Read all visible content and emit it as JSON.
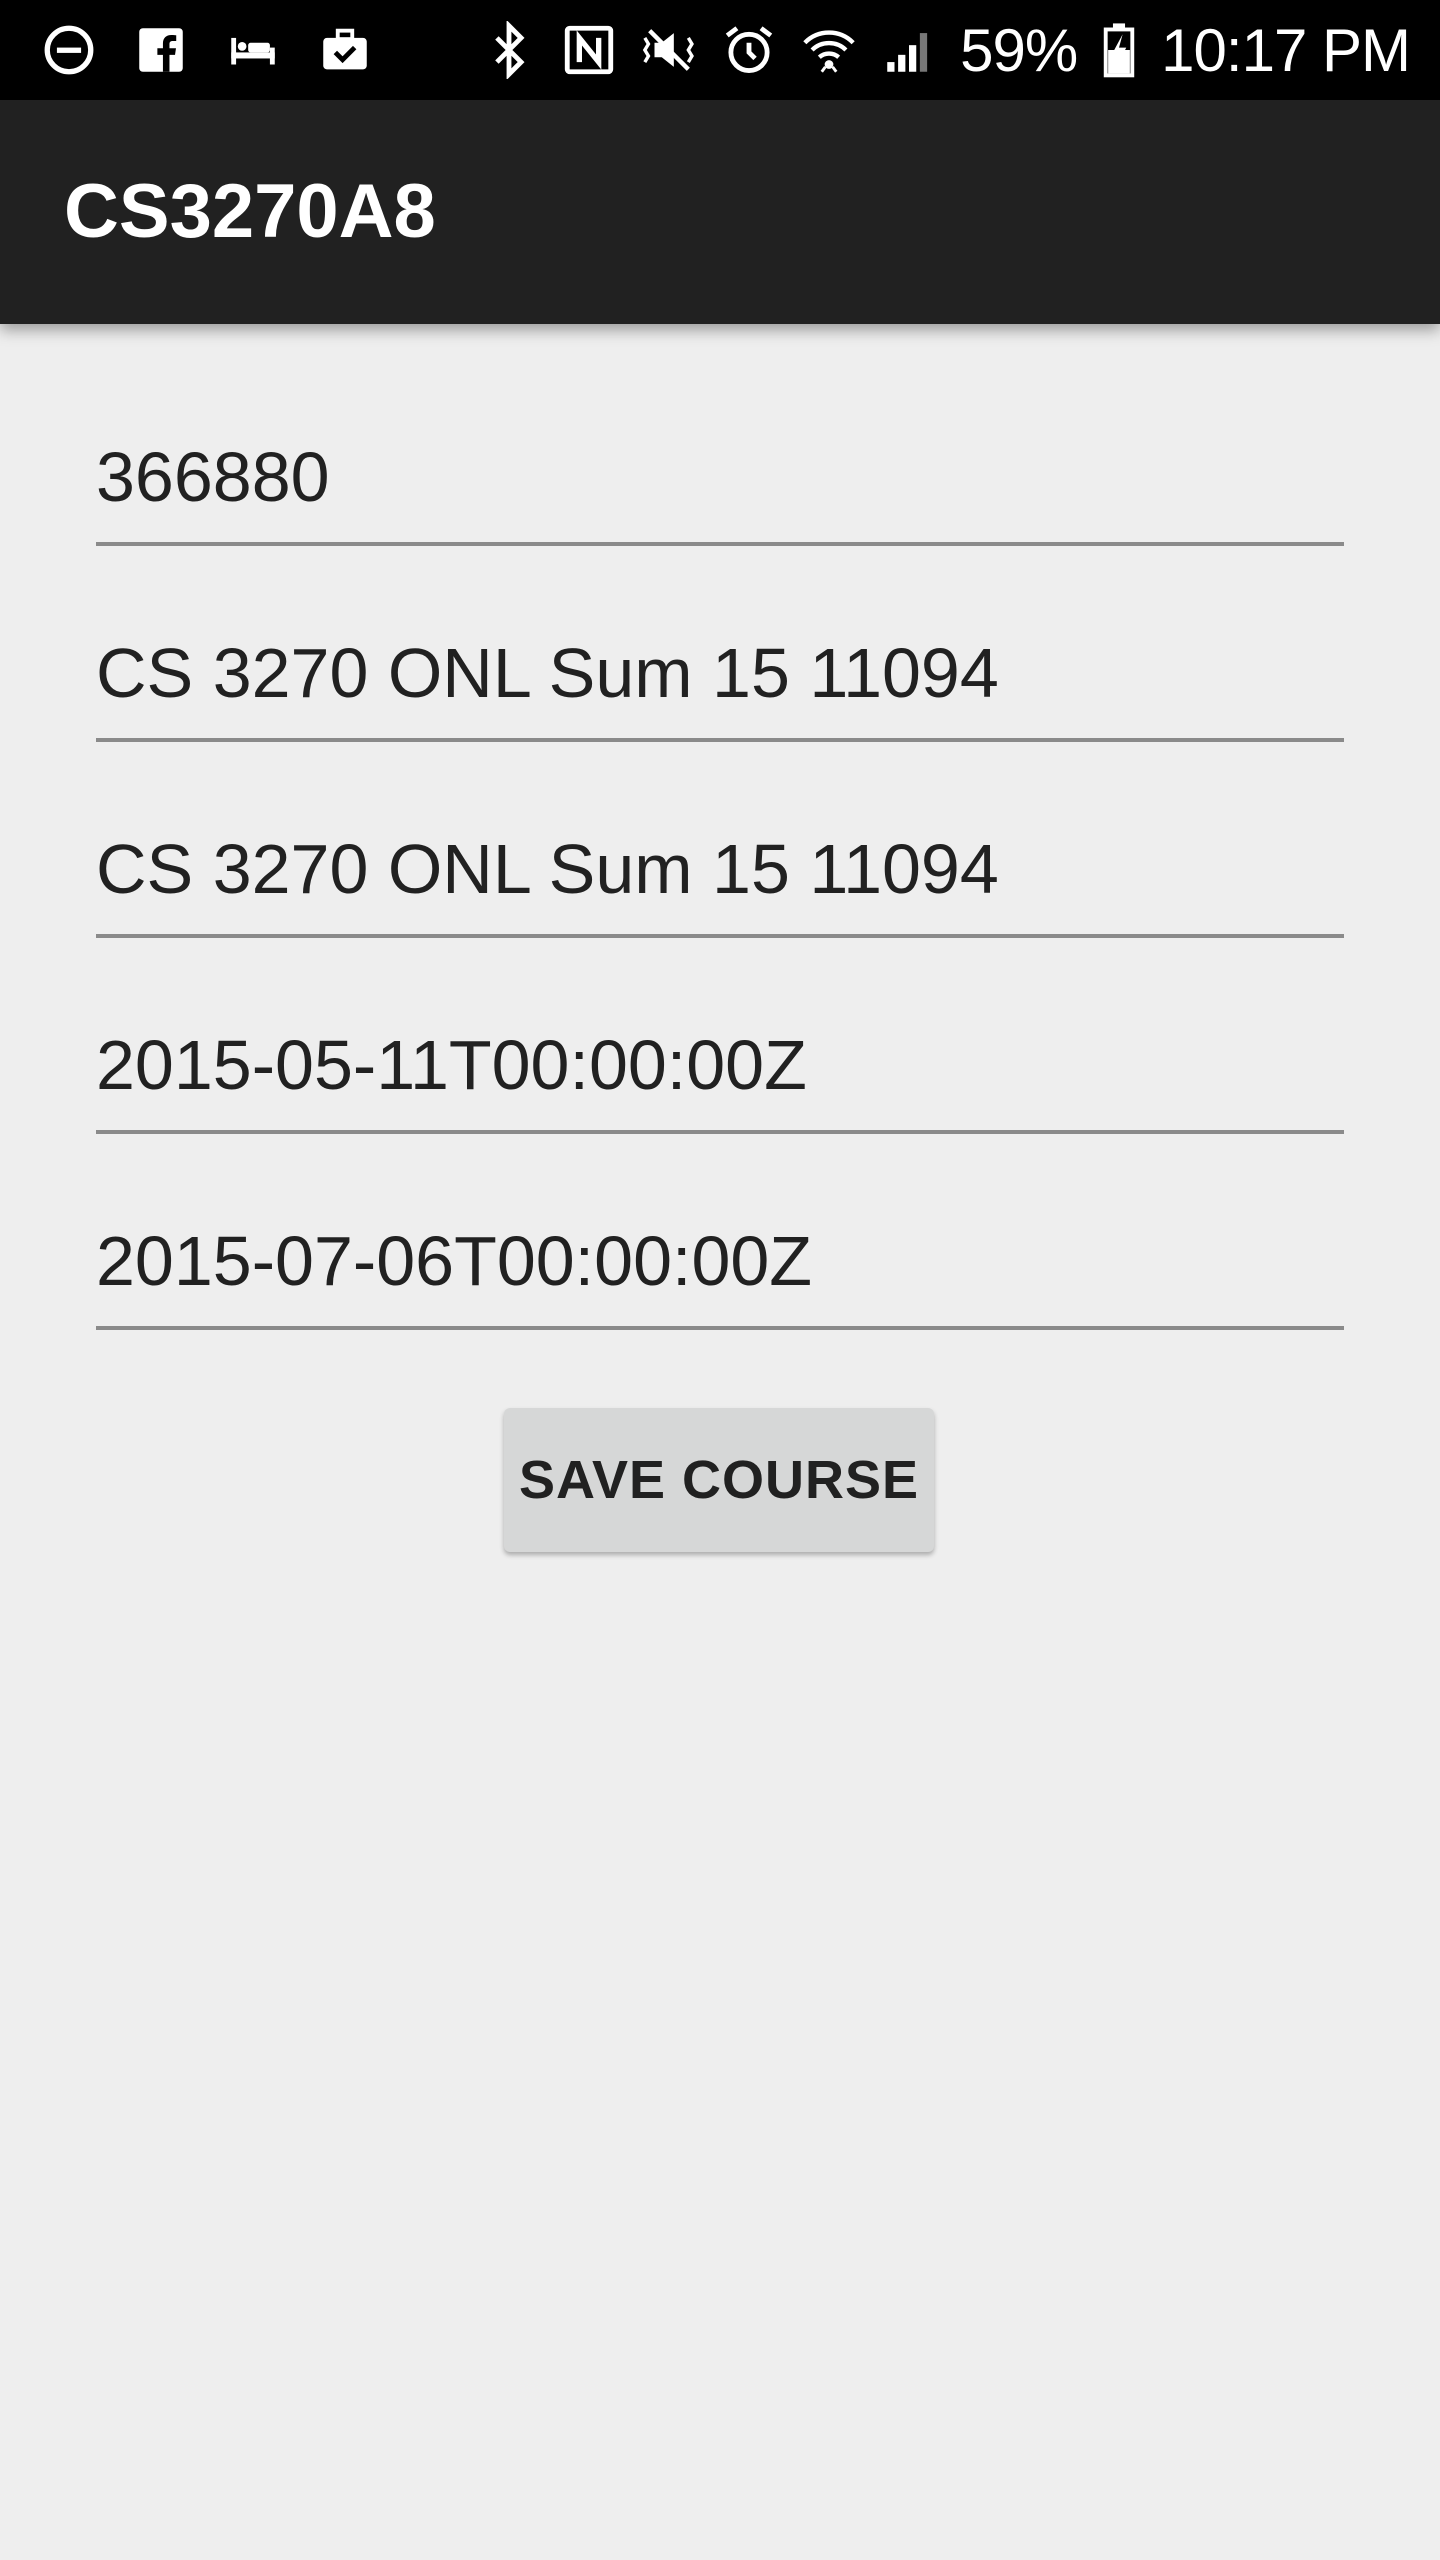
{
  "status_bar": {
    "left_icons": [
      "do-not-disturb-icon",
      "facebook-icon",
      "sleep-icon",
      "briefcase-check-icon"
    ],
    "right_icons": [
      "bluetooth-icon",
      "nfc-icon",
      "vibrate-icon",
      "alarm-icon",
      "wifi-icon",
      "cell-signal-icon"
    ],
    "battery_percent": "59%",
    "battery_icon": "battery-charging-icon",
    "time": "10:17 PM"
  },
  "app_bar": {
    "title": "CS3270A8"
  },
  "form": {
    "fields": [
      {
        "name": "course-id-field",
        "value": "366880"
      },
      {
        "name": "course-name-field",
        "value": "CS 3270 ONL Sum 15 11094"
      },
      {
        "name": "course-code-field",
        "value": "CS 3270 ONL Sum 15 11094"
      },
      {
        "name": "start-date-field",
        "value": "2015-05-11T00:00:00Z"
      },
      {
        "name": "end-date-field",
        "value": "2015-07-06T00:00:00Z"
      }
    ],
    "save_label": "SAVE COURSE"
  },
  "colors": {
    "status_bar": "#000000",
    "app_bar": "#212121",
    "background": "#eeeeee",
    "button": "#d6d7d7",
    "underline": "#8a8a8a"
  }
}
